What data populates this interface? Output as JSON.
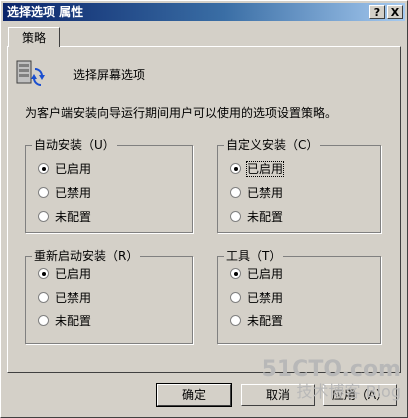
{
  "window": {
    "title": "选择选项 属性",
    "help": "?",
    "close": "X"
  },
  "tab": {
    "label": "策略"
  },
  "policy": {
    "name": "选择屏幕选项",
    "description": "为客户端安装向导运行期间用户可以使用的选项设置策略。"
  },
  "groups": [
    {
      "legend": "自动安装（U）",
      "options": [
        "已启用",
        "已禁用",
        "未配置"
      ],
      "selected": 0
    },
    {
      "legend": "自定义安装（C）",
      "options": [
        "已启用",
        "已禁用",
        "未配置"
      ],
      "selected": 0
    },
    {
      "legend": "重新启动安装（R）",
      "options": [
        "已启用",
        "已禁用",
        "未配置"
      ],
      "selected": 0
    },
    {
      "legend": "工具（T）",
      "options": [
        "已启用",
        "已禁用",
        "未配置"
      ],
      "selected": 0
    }
  ],
  "buttons": {
    "ok": "确定",
    "cancel": "取消",
    "apply": "应用（A）"
  },
  "watermark": {
    "line1": "51CTO.com",
    "line2": "技术博客 Blog"
  }
}
